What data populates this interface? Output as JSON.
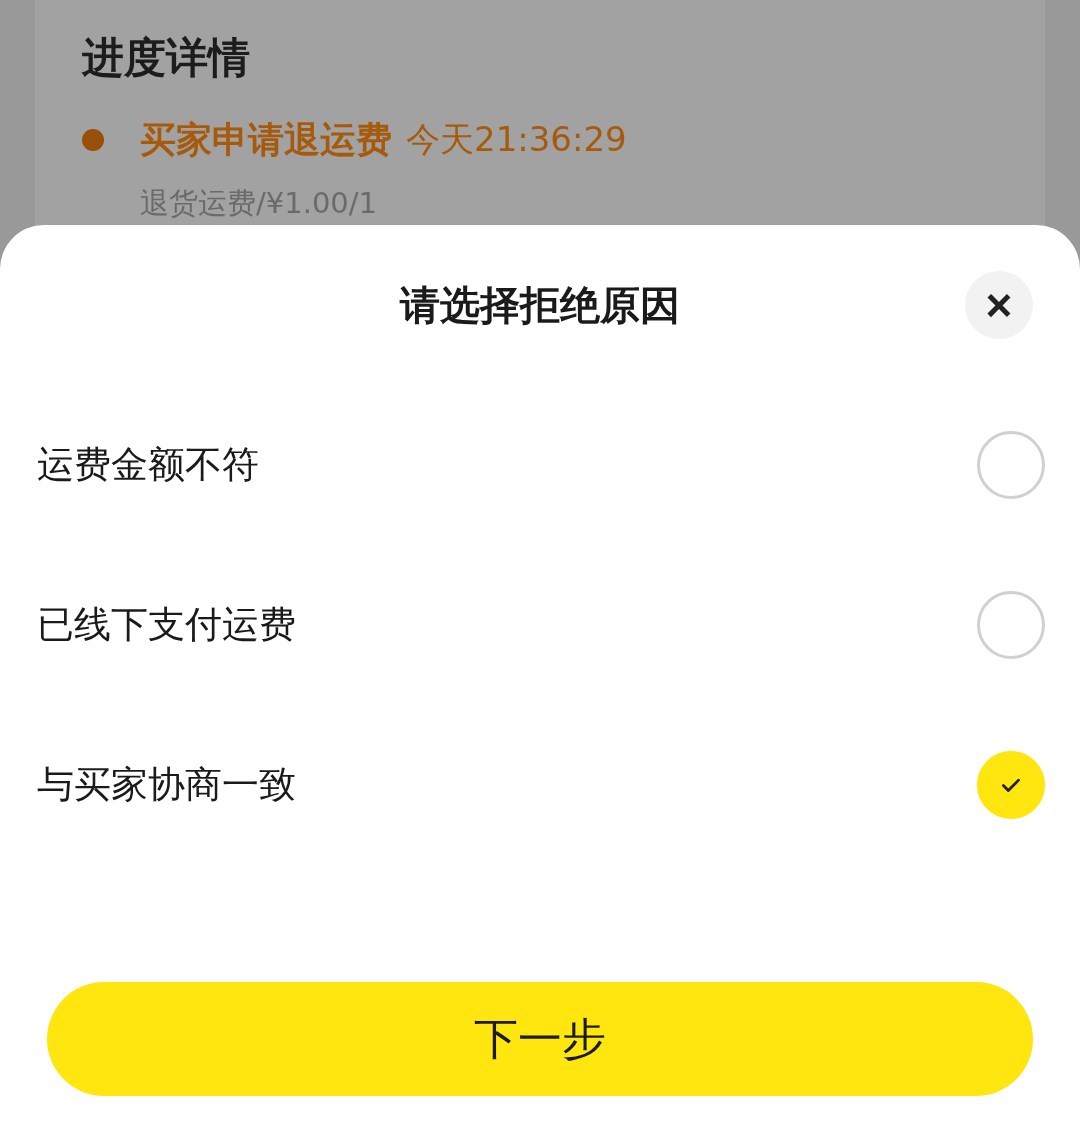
{
  "background": {
    "heading": "进度详情",
    "event": {
      "title": "买家申请退运费",
      "time": "今天21:36:29",
      "detail": "退货运费/¥1.00/1"
    }
  },
  "dialog": {
    "title": "请选择拒绝原因",
    "close": "×",
    "options": [
      {
        "label": "运费金额不符",
        "selected": false
      },
      {
        "label": "已线下支付运费",
        "selected": false
      },
      {
        "label": "与买家协商一致",
        "selected": true
      }
    ],
    "button": "下一步"
  }
}
